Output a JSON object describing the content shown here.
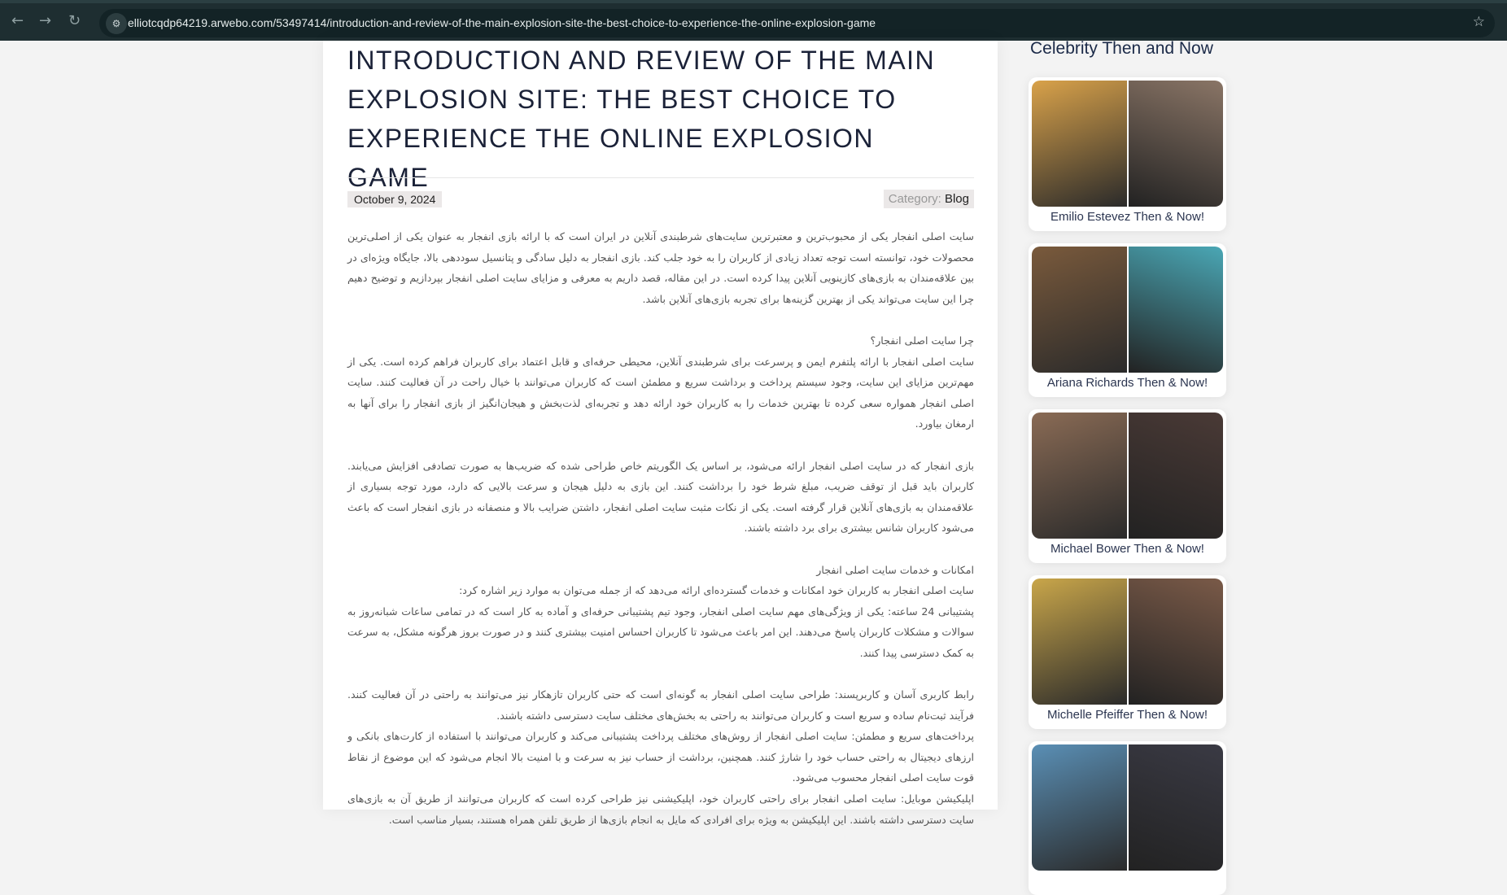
{
  "browser": {
    "url": "elliotcqdp64219.arwebo.com/53497414/introduction-and-review-of-the-main-explosion-site-the-best-choice-to-experience-the-online-explosion-game",
    "back": "←",
    "forward": "→",
    "reload": "↻",
    "site_info": "⚙",
    "bookmark": "☆"
  },
  "article": {
    "title": "Introduction and review of the main explosion site: the best choice to experience the online explosion game",
    "date": "October 9, 2024",
    "category_label": "Category:",
    "category": "Blog",
    "paragraphs": [
      "سایت اصلی انفجار یکی از محبوب‌ترین و معتبرترین سایت‌های شرطبندی آنلاین در ایران است که با ارائه بازی انفجار به عنوان یکی از اصلی‌ترین محصولات خود، توانسته است توجه تعداد زیادی از کاربران را به خود جلب کند. بازی انفجار به دلیل سادگی و پتانسیل سوددهی بالا، جایگاه ویژه‌ای در بین علاقه‌مندان به بازی‌های کازینویی آنلاین پیدا کرده است. در این مقاله، قصد داریم به معرفی و مزایای سایت اصلی انفجار بپردازیم و توضیح دهیم چرا این سایت می‌تواند یکی از بهترین گزینه‌ها برای تجربه بازی‌های آنلاین باشد.",
      "چرا سایت اصلی انفجار؟",
      "سایت اصلی انفجار با ارائه پلتفرم ایمن و پرسرعت برای شرطبندی آنلاین، محیطی حرفه‌ای و قابل اعتماد برای کاربران فراهم کرده است. یکی از مهم‌ترین مزایای این سایت، وجود سیستم پرداخت و برداشت سریع و مطمئن است که کاربران می‌توانند با خیال راحت در آن فعالیت کنند. سایت اصلی انفجار همواره سعی کرده تا بهترین خدمات را به کاربران خود ارائه دهد و تجربه‌ای لذت‌بخش و هیجان‌انگیز از بازی انفجار را برای آنها به ارمغان بیاورد.",
      "بازی انفجار که در سایت اصلی انفجار ارائه می‌شود، بر اساس یک الگوریتم خاص طراحی شده که ضریب‌ها به صورت تصادفی افزایش می‌یابند. کاربران باید قبل از توقف ضریب، مبلغ شرط خود را برداشت کنند. این بازی به دلیل هیجان و سرعت بالایی که دارد، مورد توجه بسیاری از علاقه‌مندان به بازی‌های آنلاین قرار گرفته است. یکی از نکات مثبت سایت اصلی انفجار، داشتن ضرایب بالا و منصفانه در بازی انفجار است که باعث می‌شود کاربران شانس بیشتری برای برد داشته باشند.",
      "امکانات و خدمات سایت اصلی انفجار",
      "سایت اصلی انفجار به کاربران خود امکانات و خدمات گسترده‌ای ارائه می‌دهد که از جمله می‌توان به موارد زیر اشاره کرد:",
      "پشتیبانی 24 ساعته: یکی از ویژگی‌های مهم سایت اصلی انفجار، وجود تیم پشتیبانی حرفه‌ای و آماده به کار است که در تمامی ساعات شبانه‌روز به سوالات و مشکلات کاربران پاسخ می‌دهند. این امر باعث می‌شود تا کاربران احساس امنیت بیشتری کنند و در صورت بروز هرگونه مشکل، به سرعت به کمک دسترسی پیدا کنند.",
      "رابط کاربری آسان و کاربرپسند: طراحی سایت اصلی انفجار به گونه‌ای است که حتی کاربران تازهکار نیز می‌توانند به راحتی در آن فعالیت کنند. فرآیند ثبت‌نام ساده و سریع است و کاربران می‌توانند به راحتی به بخش‌های مختلف سایت دسترسی داشته باشند.",
      "پرداخت‌های سریع و مطمئن: سایت اصلی انفجار از روش‌های مختلف پرداخت پشتیبانی می‌کند و کاربران می‌توانند با استفاده از کارت‌های بانکی و ارزهای دیجیتال به راحتی حساب خود را شارژ کنند. همچنین، برداشت از حساب نیز به سرعت و با امنیت بالا انجام می‌شود که این موضوع از نقاط قوت سایت اصلی انفجار محسوب می‌شود.",
      "اپلیکیشن موبایل: سایت اصلی انفجار برای راحتی کاربران خود، اپلیکیشنی نیز طراحی کرده است که کاربران می‌توانند از طریق آن به بازی‌های سایت دسترسی داشته باشند. این اپلیکیشن به ویژه برای افرادی که مایل به انجام بازی‌ها از طریق تلفن همراه هستند، بسیار مناسب است."
    ]
  },
  "sidebar": {
    "title": "Celebrity Then and Now",
    "items": [
      {
        "caption": "Emilio Estevez Then & Now!",
        "then_color": "#d9a24a",
        "now_color": "#8a7566"
      },
      {
        "caption": "Ariana Richards Then & Now!",
        "then_color": "#7a5a3c",
        "now_color": "#4aa7b5"
      },
      {
        "caption": "Michael Bower Then & Now!",
        "then_color": "#8a6b55",
        "now_color": "#4a3a36"
      },
      {
        "caption": "Michelle Pfeiffer Then & Now!",
        "then_color": "#c9a64a",
        "now_color": "#7a5a48"
      },
      {
        "caption": "",
        "then_color": "#5a8fb5",
        "now_color": "#3a3a44"
      }
    ]
  }
}
